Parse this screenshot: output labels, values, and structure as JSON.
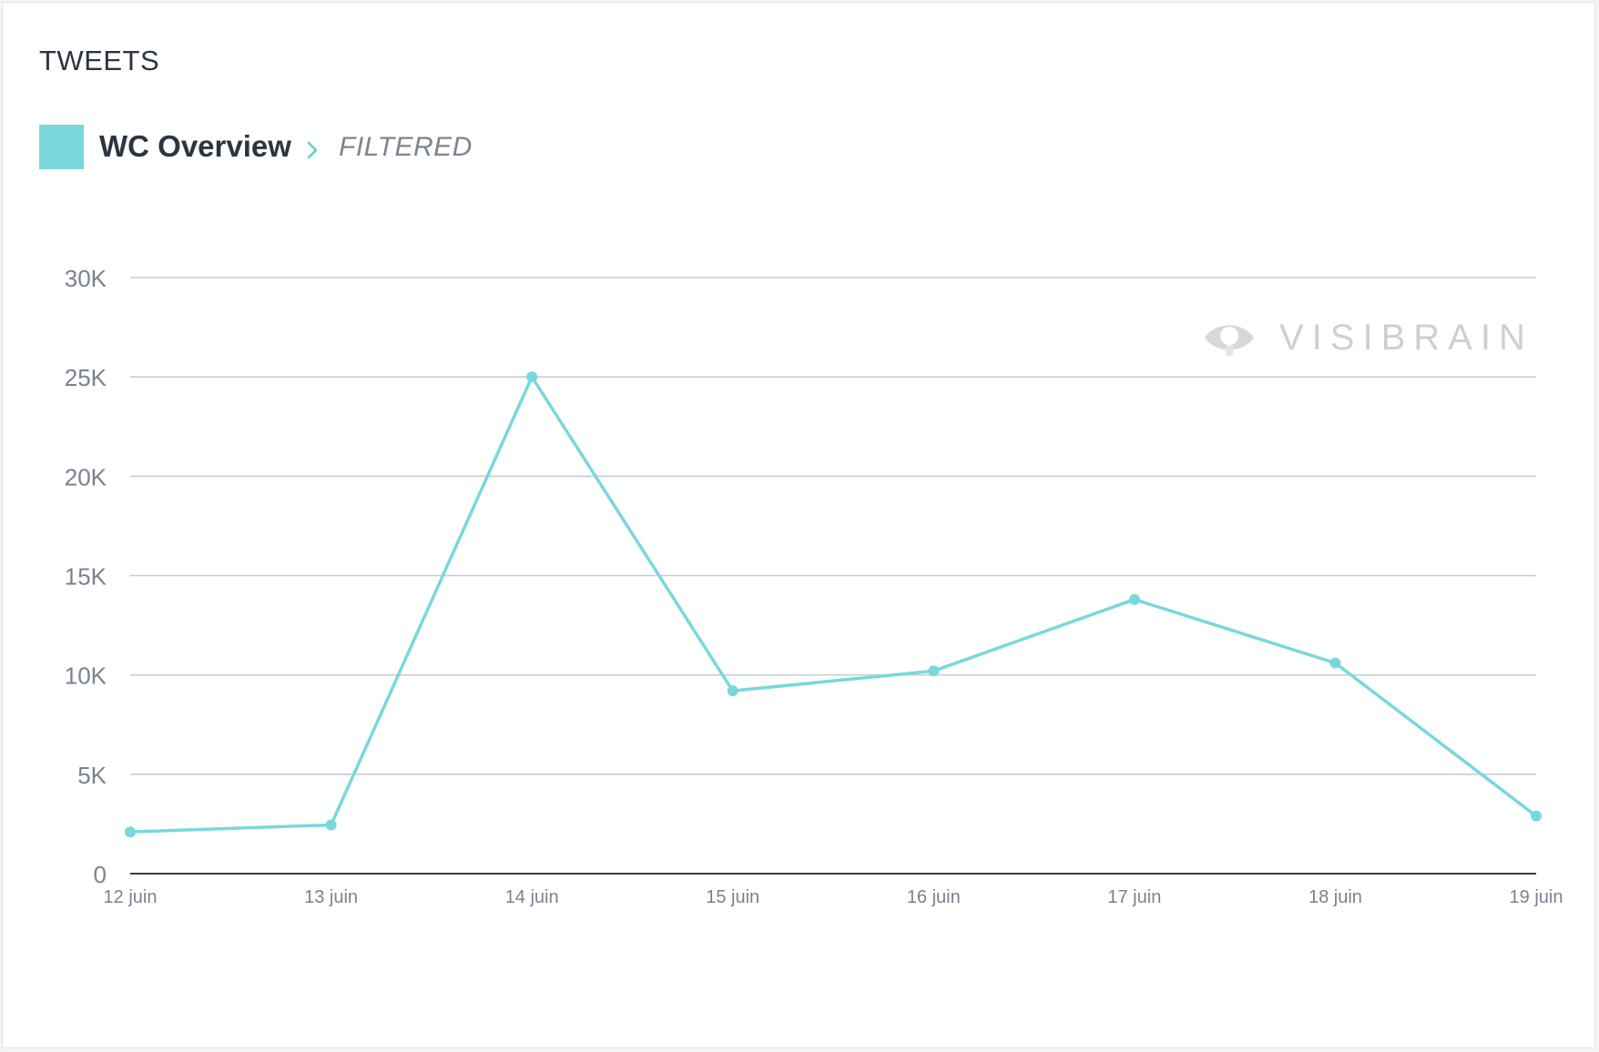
{
  "panel": {
    "title": "TWEETS"
  },
  "legend": {
    "series_name": "WC Overview",
    "filter_label": "FILTERED",
    "chevron_icon": "chevron-right-icon"
  },
  "watermark": {
    "text": "VISIBRAIN",
    "icon": "eye-icon"
  },
  "colors": {
    "series": "#78d8dc",
    "grid": "#c8ccd2",
    "axis": "#3a3f45",
    "tick_text": "#7a8290"
  },
  "chart_data": {
    "type": "line",
    "title": "",
    "xlabel": "",
    "ylabel": "",
    "categories": [
      "12 juin",
      "13 juin",
      "14 juin",
      "15 juin",
      "16 juin",
      "17 juin",
      "18 juin",
      "19 juin"
    ],
    "series": [
      {
        "name": "WC Overview",
        "values": [
          2100,
          2450,
          25000,
          9200,
          10200,
          13800,
          10600,
          2900
        ]
      }
    ],
    "ylim": [
      0,
      30000
    ],
    "y_ticks": [
      0,
      5000,
      10000,
      15000,
      20000,
      25000,
      30000
    ],
    "y_tick_labels": [
      "0",
      "5K",
      "10K",
      "15K",
      "20K",
      "25K",
      "30K"
    ],
    "grid": true,
    "legend_position": "top-left"
  }
}
